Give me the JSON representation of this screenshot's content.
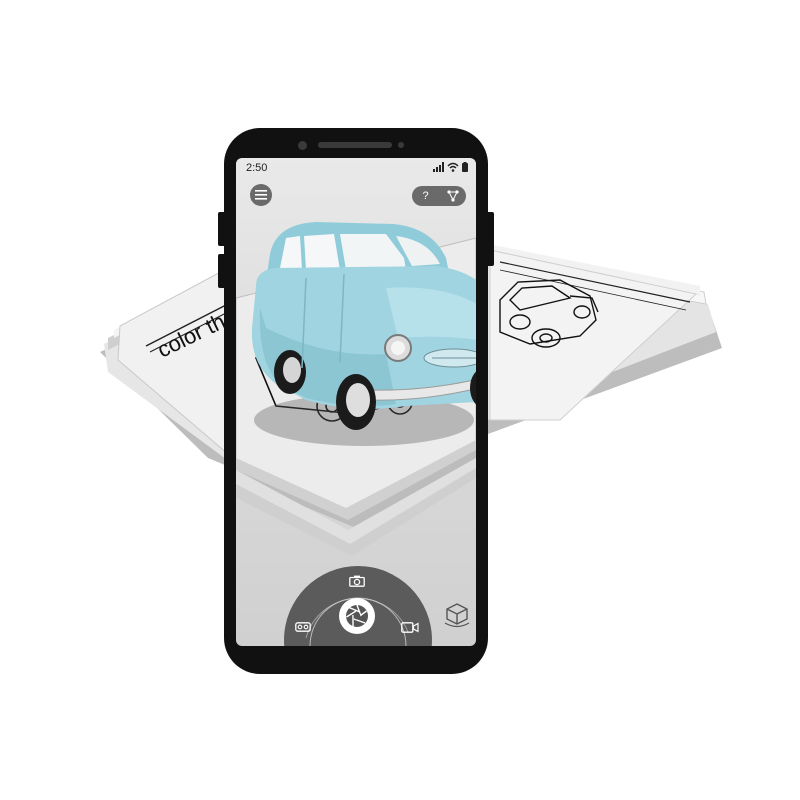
{
  "book": {
    "left_page_text": "color th",
    "right_page_text": "car"
  },
  "status_bar": {
    "time": "2:50",
    "icons": [
      "signal-icon",
      "wifi-icon",
      "battery-icon"
    ]
  },
  "toolbar": {
    "menu_icon": "hamburger-menu-icon",
    "help_label": "?",
    "help_icon": "help-icon",
    "share_icon": "share-icon"
  },
  "controls": {
    "photo_icon": "camera-icon",
    "shutter_icon": "shutter-aperture-icon",
    "vr_icon": "vr-goggles-icon",
    "video_icon": "video-camera-icon",
    "ar_icon": "ar-cube-icon"
  },
  "colors": {
    "car_body": "#9fd4e0",
    "phone_frame": "#111111",
    "control_gray": "#555555"
  }
}
